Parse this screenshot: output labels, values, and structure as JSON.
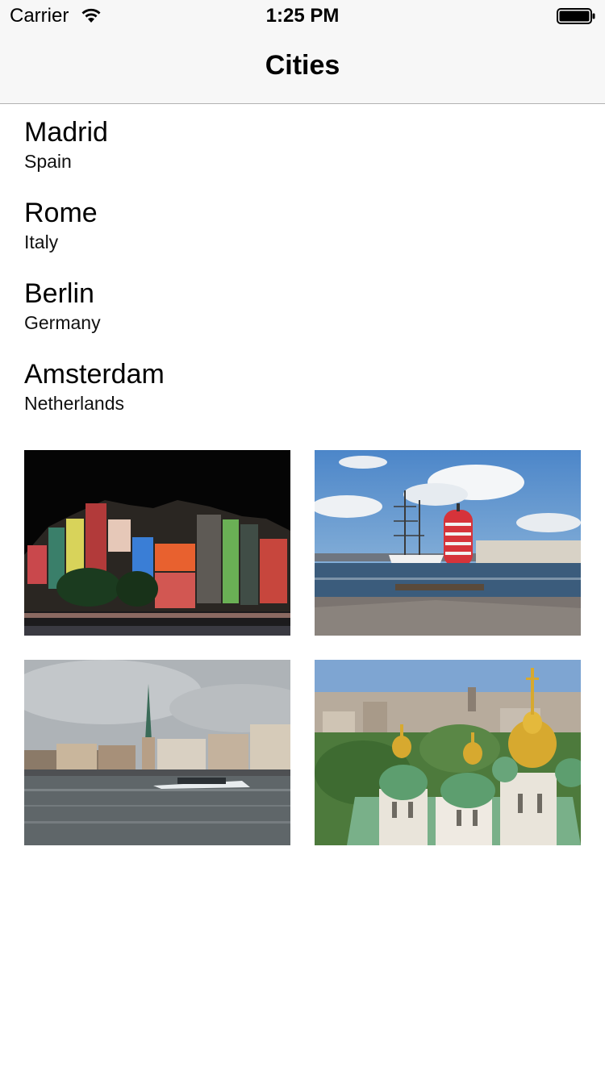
{
  "status_bar": {
    "carrier": "Carrier",
    "time": "1:25 PM"
  },
  "nav": {
    "title": "Cities"
  },
  "cities": [
    {
      "name": "Madrid",
      "country": "Spain"
    },
    {
      "name": "Rome",
      "country": "Italy"
    },
    {
      "name": "Berlin",
      "country": "Germany"
    },
    {
      "name": "Amsterdam",
      "country": "Netherlands"
    }
  ],
  "photos": [
    {
      "subject": "night-city-street-photo"
    },
    {
      "subject": "harbor-tall-ship-photo"
    },
    {
      "subject": "river-old-town-photo"
    },
    {
      "subject": "green-domed-cathedral-photo"
    }
  ],
  "colors": {
    "nav_background": "#f7f7f7",
    "separator": "#b2b2b2"
  }
}
